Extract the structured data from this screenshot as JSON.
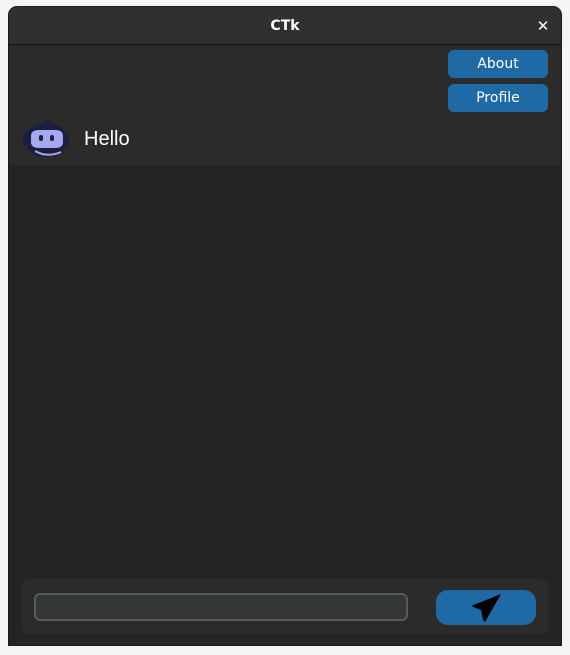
{
  "window": {
    "title": "CTk",
    "close_glyph": "✕"
  },
  "header": {
    "about_label": "About",
    "profile_label": "Profile"
  },
  "chat": {
    "bot_avatar_icon": "robot-icon",
    "greeting": "Hello",
    "messages": []
  },
  "composer": {
    "input_value": "",
    "input_placeholder": "",
    "send_icon": "paper-plane-icon"
  },
  "colors": {
    "background": "#242424",
    "panel": "#2b2b2b",
    "accent": "#1f6aa5",
    "text": "#ffffff",
    "avatar": "#1b1f3f"
  }
}
